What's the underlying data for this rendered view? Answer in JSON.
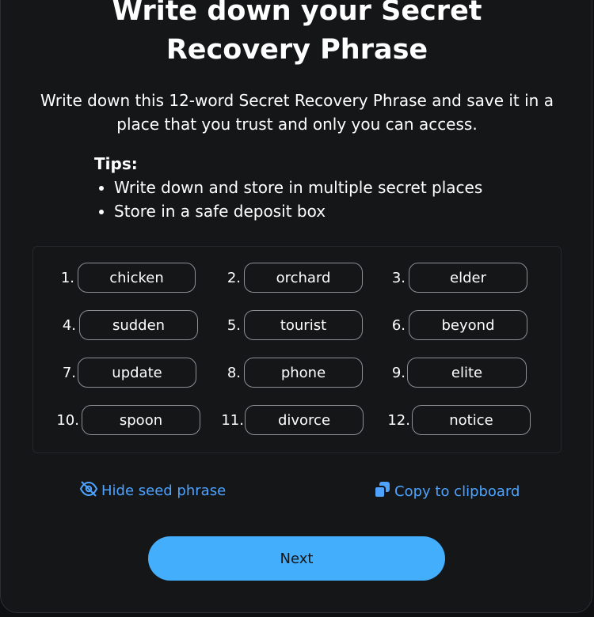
{
  "page": {
    "title_line1": "Write down your Secret",
    "title_line2": "Recovery Phrase",
    "description_line1": "Write down this 12-word Secret Recovery Phrase and save it in a",
    "description_line2": "place that you trust and only you can access."
  },
  "tips": {
    "heading": "Tips:",
    "items": [
      "Write down and store in multiple secret places",
      "Store in a safe deposit box"
    ]
  },
  "seed_words": [
    {
      "num": "1.",
      "word": "chicken"
    },
    {
      "num": "2.",
      "word": "orchard"
    },
    {
      "num": "3.",
      "word": "elder"
    },
    {
      "num": "4.",
      "word": "sudden"
    },
    {
      "num": "5.",
      "word": "tourist"
    },
    {
      "num": "6.",
      "word": "beyond"
    },
    {
      "num": "7.",
      "word": "update"
    },
    {
      "num": "8.",
      "word": "phone"
    },
    {
      "num": "9.",
      "word": "elite"
    },
    {
      "num": "10.",
      "word": "spoon"
    },
    {
      "num": "11.",
      "word": "divorce"
    },
    {
      "num": "12.",
      "word": "notice"
    }
  ],
  "actions": {
    "hide_label": "Hide seed phrase",
    "hide_icon": "eye-slash-icon",
    "copy_label": "Copy to clipboard",
    "copy_icon": "copy-icon"
  },
  "next_button": {
    "label": "Next"
  },
  "colors": {
    "background": "#141618",
    "accent": "#43aefc",
    "link": "#4da3ff"
  }
}
